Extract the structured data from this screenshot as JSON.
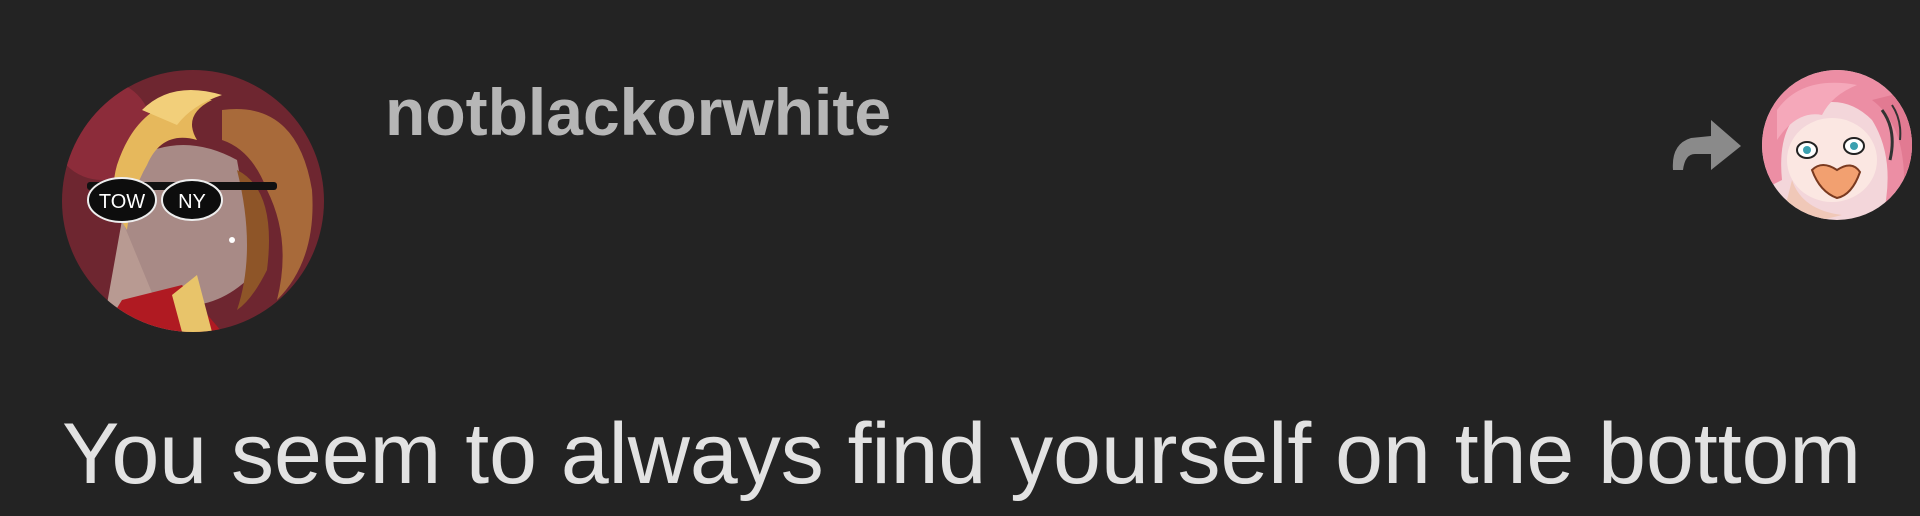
{
  "post": {
    "username": "notblackorwhite",
    "body_text": "You seem to always find yourself on the bottom",
    "avatar_glasses_text": "TOW NY"
  },
  "icons": {
    "reblog": "reblog-arrow-icon"
  },
  "colors": {
    "background": "#232323",
    "username": "#b6b6b6",
    "body_text": "#e2e2e2",
    "icon": "#8a8a8a"
  }
}
